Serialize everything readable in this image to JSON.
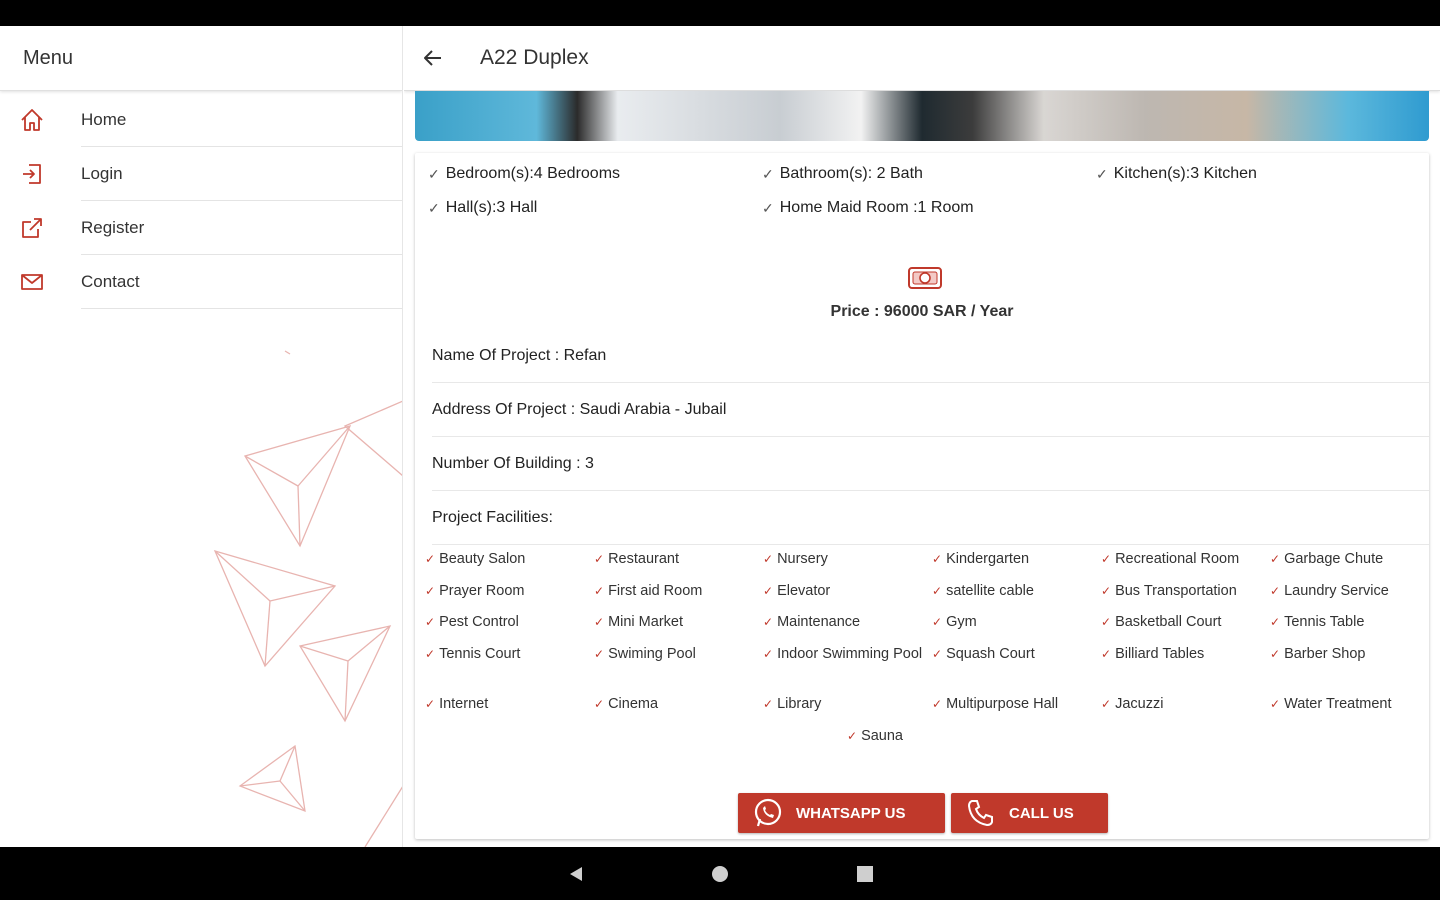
{
  "drawer": {
    "title": "Menu",
    "items": [
      {
        "label": "Home",
        "icon": "home-icon"
      },
      {
        "label": "Login",
        "icon": "login-icon"
      },
      {
        "label": "Register",
        "icon": "external-link-icon"
      },
      {
        "label": "Contact",
        "icon": "mail-icon"
      }
    ]
  },
  "header": {
    "title": "A22 Duplex",
    "back_icon": "arrow-left-icon"
  },
  "specs": [
    "Bedroom(s):4 Bedrooms",
    "Bathroom(s): 2 Bath",
    "Kitchen(s):3 Kitchen",
    "Hall(s):3 Hall",
    "Home Maid Room :1 Room"
  ],
  "price": {
    "icon": "money-icon",
    "text": "Price : 96000 SAR / Year"
  },
  "project": {
    "name": "Name Of Project : Refan",
    "address": "Address Of Project : Saudi Arabia - Jubail",
    "buildings": "Number Of Building : 3",
    "facilities_title": "Project Facilities:"
  },
  "facilities": [
    "Beauty Salon",
    "Restaurant",
    "Nursery",
    "Kindergarten",
    "Recreational Room",
    "Garbage Chute",
    "Prayer Room",
    "First aid Room",
    "Elevator",
    "satellite cable",
    "Bus Transportation",
    "Laundry Service",
    "Pest Control",
    "Mini Market",
    "Maintenance",
    "Gym",
    "Basketball Court",
    "Tennis Table",
    "Tennis Court",
    "Swiming Pool",
    "Indoor Swimming Pool",
    "Squash Court",
    "Billiard Tables",
    "Barber Shop",
    "Internet",
    "Cinema",
    "Library",
    "Multipurpose Hall",
    "Jacuzzi",
    "Water Treatment",
    "Sauna"
  ],
  "actions": {
    "whatsapp": "WHATSAPP US",
    "call": "CALL US"
  },
  "colors": {
    "accent": "#c0392b",
    "text": "#222222"
  }
}
